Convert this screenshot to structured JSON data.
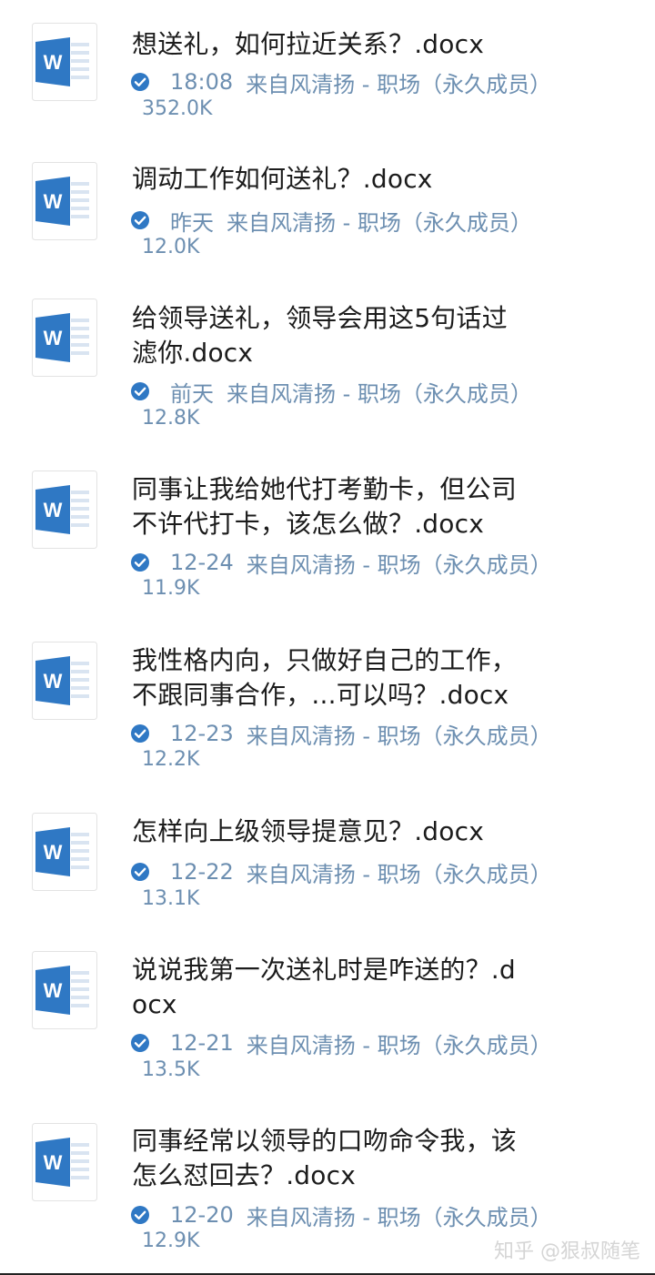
{
  "colors": {
    "accent": "#2f78c4",
    "meta_text": "#6d8fb1",
    "title_text": "#1c1c1c",
    "watermark": "#d5d5d5"
  },
  "files": [
    {
      "title_lines": [
        "想送礼，如何拉近关系？.docx"
      ],
      "time": "18:08",
      "source": "来自风清扬 - 职场（永久成员）",
      "size": "352.0K",
      "icon": "word-doc-icon"
    },
    {
      "title_lines": [
        "调动工作如何送礼？.docx"
      ],
      "time": "昨天",
      "source": "来自风清扬 - 职场（永久成员）",
      "size": "12.0K",
      "icon": "word-doc-icon"
    },
    {
      "title_lines": [
        "给领导送礼，领导会用这5句话过",
        "滤你.docx"
      ],
      "time": "前天",
      "source": "来自风清扬 - 职场（永久成员）",
      "size": "12.8K",
      "icon": "word-doc-icon"
    },
    {
      "title_lines": [
        "同事让我给她代打考勤卡，但公司",
        "不许代打卡，该怎么做？.docx"
      ],
      "time": "12-24",
      "source": "来自风清扬 - 职场（永久成员）",
      "size": "11.9K",
      "icon": "word-doc-icon"
    },
    {
      "title_lines": [
        "我性格内向，只做好自己的工作，",
        "不跟同事合作，...可以吗？.docx"
      ],
      "time": "12-23",
      "source": "来自风清扬 - 职场（永久成员）",
      "size": "12.2K",
      "icon": "word-doc-icon"
    },
    {
      "title_lines": [
        "怎样向上级领导提意见？.docx"
      ],
      "time": "12-22",
      "source": "来自风清扬 - 职场（永久成员）",
      "size": "13.1K",
      "icon": "word-doc-icon"
    },
    {
      "title_lines": [
        "说说我第一次送礼时是咋送的？.d",
        "ocx"
      ],
      "time": "12-21",
      "source": "来自风清扬 - 职场（永久成员）",
      "size": "13.5K",
      "icon": "word-doc-icon"
    },
    {
      "title_lines": [
        "同事经常以领导的口吻命令我，该",
        "怎么怼回去？.docx"
      ],
      "time": "12-20",
      "source": "来自风清扬 - 职场（永久成员）",
      "size": "12.9K",
      "icon": "word-doc-icon"
    }
  ],
  "watermark": "知乎 @狠叔随笔"
}
